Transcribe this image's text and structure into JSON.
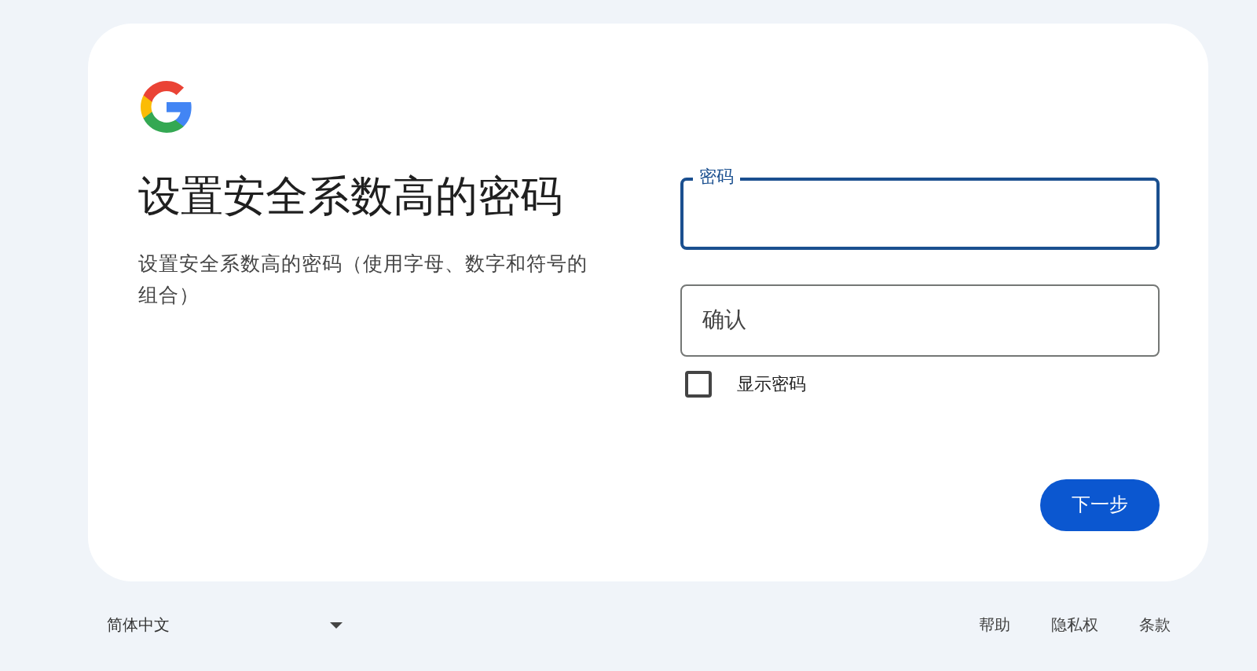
{
  "card": {
    "title": "设置安全系数高的密码",
    "description": "设置安全系数高的密码（使用字母、数字和符号的组合）",
    "fields": [
      {
        "label": "密码",
        "focused": true
      },
      {
        "label": "确认",
        "focused": false
      }
    ],
    "show_password": {
      "label": "显示密码",
      "checked": false
    },
    "next_button": "下一步"
  },
  "footer": {
    "language": "简体中文",
    "links": [
      "帮助",
      "隐私权",
      "条款"
    ]
  }
}
